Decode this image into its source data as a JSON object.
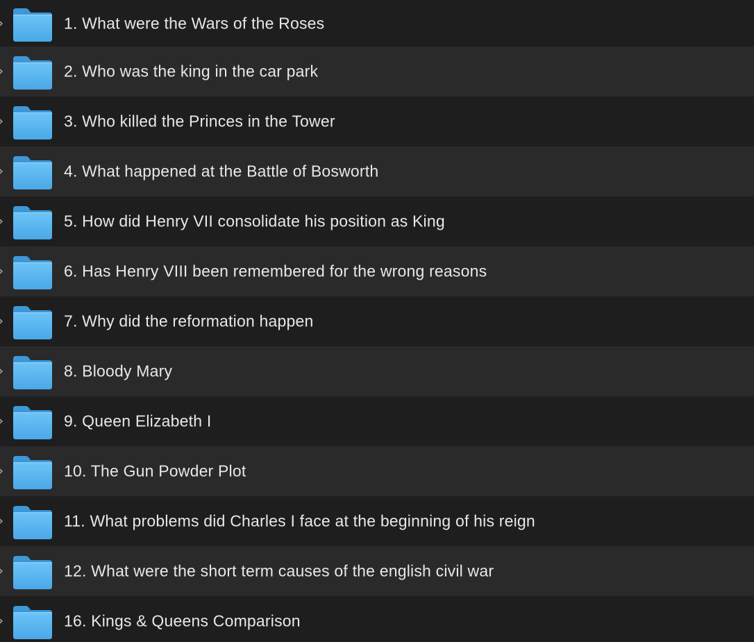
{
  "colors": {
    "row_dark": "#1e1e1e",
    "row_light": "#2a2a2a",
    "text": "#e8e8e8",
    "folder_blue": "#5cb8f0"
  },
  "folders": [
    {
      "name": "1. What were the Wars of the Roses",
      "icon": "folder-icon"
    },
    {
      "name": "2. Who was the king in the car park",
      "icon": "folder-icon"
    },
    {
      "name": "3. Who killed the Princes in the Tower",
      "icon": "folder-icon"
    },
    {
      "name": "4. What happened at the Battle of Bosworth",
      "icon": "folder-icon"
    },
    {
      "name": "5. How did Henry VII consolidate his position as King",
      "icon": "folder-icon"
    },
    {
      "name": "6. Has Henry VIII been remembered for the wrong reasons",
      "icon": "folder-icon"
    },
    {
      "name": "7. Why did the reformation happen",
      "icon": "folder-icon"
    },
    {
      "name": "8. Bloody Mary",
      "icon": "folder-icon"
    },
    {
      "name": "9. Queen Elizabeth I",
      "icon": "folder-icon"
    },
    {
      "name": "10. The Gun Powder Plot",
      "icon": "folder-icon"
    },
    {
      "name": "11. What problems did Charles I face at the beginning of his reign",
      "icon": "folder-icon"
    },
    {
      "name": "12. What were the short term causes of the english civil war",
      "icon": "folder-icon"
    },
    {
      "name": "16. Kings & Queens Comparison",
      "icon": "folder-icon"
    }
  ]
}
